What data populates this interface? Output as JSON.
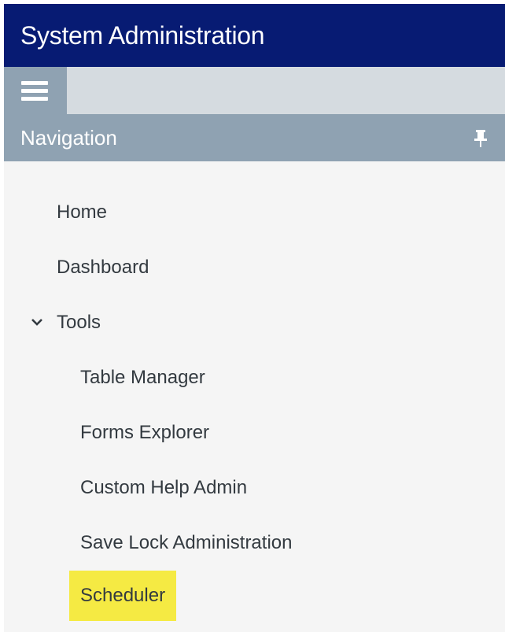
{
  "window": {
    "title": "System Administration"
  },
  "toolbar": {
    "menu_icon": "hamburger-menu-icon"
  },
  "navigation": {
    "header": "Navigation",
    "pin_icon": "pin-icon",
    "items": [
      {
        "label": "Home",
        "level": 0
      },
      {
        "label": "Dashboard",
        "level": 0
      },
      {
        "label": "Tools",
        "level": 0,
        "expanded": true,
        "icon": "chevron-down-icon"
      },
      {
        "label": "Table Manager",
        "level": 1
      },
      {
        "label": "Forms Explorer",
        "level": 1
      },
      {
        "label": "Custom Help Admin",
        "level": 1
      },
      {
        "label": "Save Lock Administration",
        "level": 1
      },
      {
        "label": "Scheduler",
        "level": 1,
        "highlighted": true
      }
    ]
  },
  "colors": {
    "title_bar": "#071b73",
    "toolbar": "#d5dbe0",
    "nav_header": "#8fa2b2",
    "nav_background": "#f5f5f5",
    "highlight": "#f5ea43",
    "nav_text": "#333a40"
  }
}
